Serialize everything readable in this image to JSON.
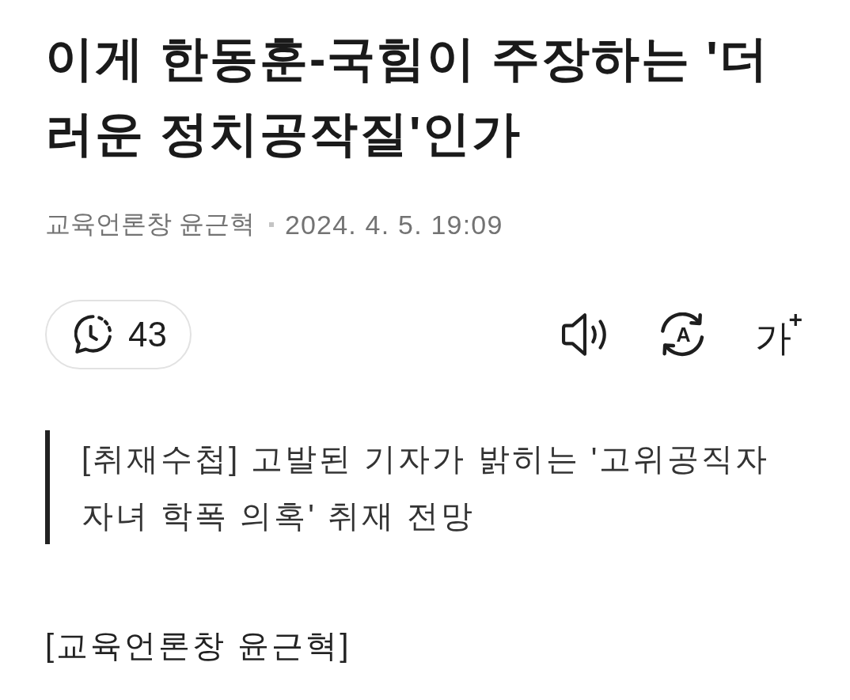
{
  "headline": "이게 한동훈-국힘이 주장하는 '더러운 정치공작질'인가",
  "byline": {
    "source": "교육언론창 윤근혁",
    "date": "2024. 4. 5. 19:09"
  },
  "toolbar": {
    "comment_count": "43",
    "translate_label": "A",
    "font_size_label": "가",
    "font_size_mark": "+"
  },
  "subtitle": "[취재수첩] 고발된 기자가 밝히는 '고위공직자 자녀 학폭 의혹' 취재 전망",
  "paragraphs": [
    "[교육언론창 윤근혁]"
  ]
}
